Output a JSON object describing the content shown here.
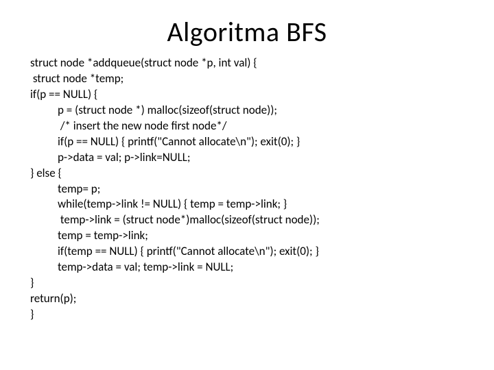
{
  "title": "Algoritma BFS",
  "code": {
    "l0": "struct node *addqueue(struct node *p, int val) {",
    "l1": " struct node *temp;",
    "l2": "if(p == NULL) {",
    "l3": "p = (struct node *) malloc(sizeof(struct node));",
    "l4": " /* insert the new node first node*/",
    "l5": "if(p == NULL) { printf(\"Cannot allocate\\n\"); exit(0); }",
    "l6": "p->data = val; p->link=NULL;",
    "l7": "} else {",
    "l8": "temp= p;",
    "l9": "while(temp->link != NULL) { temp = temp->link; }",
    "l10": " temp->link = (struct node*)malloc(sizeof(struct node));",
    "l11": "temp = temp->link;",
    "l12": "if(temp == NULL) { printf(\"Cannot allocate\\n\"); exit(0); }",
    "l13": "temp->data = val; temp->link = NULL;",
    "l14": "}",
    "l15": "return(p);",
    "l16": "}"
  }
}
